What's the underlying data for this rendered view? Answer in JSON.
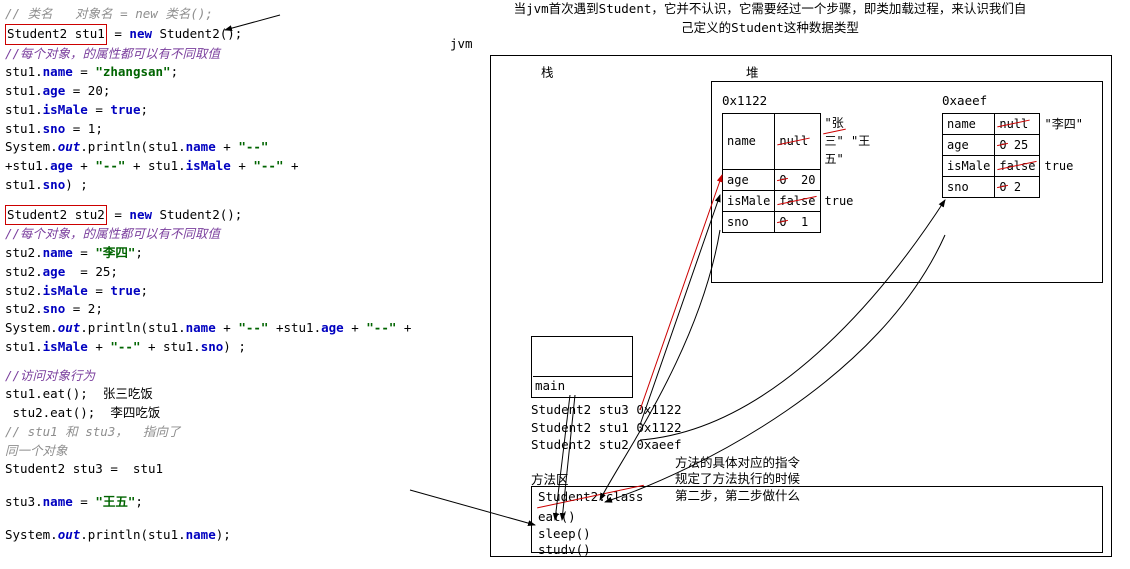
{
  "code": {
    "c0": "// 类名   对象名 = new 类名();",
    "l1a": "Student2 stu1",
    "l1b": " = ",
    "l1c": "new",
    "l1d": " Student2();",
    "c1": "//每个对象，的属性都可以有不同取值",
    "l2a": "stu1.",
    "l2b": "name",
    "l2c": " = ",
    "l2d": "\"zhangsan\"",
    "l2e": ";",
    "l3a": "stu1.",
    "l3b": "age",
    "l3c": " = 20;",
    "l4a": "stu1.",
    "l4b": "isMale",
    "l4c": " = ",
    "l4d": "true",
    "l4e": ";",
    "l5a": "stu1.",
    "l5b": "sno",
    "l5c": " = 1;",
    "l6a": "System.",
    "l6b": "out",
    "l6c": ".println(stu1.",
    "l6d": "name",
    "l6e": " + ",
    "l6f": "\"--\"",
    "l7a": "+stu1.",
    "l7b": "age",
    "l7c": " + ",
    "l7d": "\"--\"",
    "l7e": " + stu1.",
    "l7f": "isMale",
    "l7g": " + ",
    "l7h": "\"--\"",
    "l7i": " +",
    "l8a": "stu1.",
    "l8b": "sno",
    "l8c": ") ;",
    "l9a": "Student2 stu2",
    "l9b": " = ",
    "l9c": "new",
    "l9d": " Student2();",
    "c2": "//每个对象，的属性都可以有不同取值",
    "l10a": "stu2.",
    "l10b": "name",
    "l10c": " = ",
    "l10d": "\"李四\"",
    "l10e": ";",
    "l11a": "stu2.",
    "l11b": "age",
    "l11c": "  = 25;",
    "l12a": "stu2.",
    "l12b": "isMale",
    "l12c": " = ",
    "l12d": "true",
    "l12e": ";",
    "l13a": "stu2.",
    "l13b": "sno",
    "l13c": " = 2;",
    "l14a": "System.",
    "l14b": "out",
    "l14c": ".println(stu1.",
    "l14d": "name",
    "l14e": " + ",
    "l14f": "\"--\"",
    "l14g": " +stu1.",
    "l14h": "age",
    "l14i": " + ",
    "l14j": "\"--\"",
    "l14k": " +",
    "l15a": "stu1.",
    "l15b": "isMale",
    "l15c": " + ",
    "l15d": "\"--\"",
    "l15e": " + stu1.",
    "l15f": "sno",
    "l15g": ") ;",
    "c3": "//访问对象行为",
    "l16": "stu1.eat();  张三吃饭",
    "l17": " stu2.eat();  李四吃饭",
    "c4": "// stu1 和 stu3，  指向了",
    "c5": "同一个对象",
    "l18": "Student2 stu3 =  stu1",
    "l19a": "stu3.",
    "l19b": "name",
    "l19c": " = ",
    "l19d": "\"王五\"",
    "l19e": ";",
    "l20a": "System.",
    "l20b": "out",
    "l20c": ".println(stu1.",
    "l20d": "name",
    "l20e": ");"
  },
  "anno": {
    "top1": "当jvm首次遇到Student，它并不认识，它需要经过一个步骤，即类加载过程，来认识我们自",
    "top2": "己定义的Student这种数据类型",
    "jvm": "jvm",
    "stack": "栈",
    "heap": "堆",
    "main": "main",
    "sv1": "Student2 stu3  0x1122",
    "sv2": "Student2 stu1  0x1122",
    "sv3": "Student2 stu2  0xaeef",
    "method": "方法区",
    "mclass": "Student2.class",
    "meat": "eat()",
    "msleep": "sleep()",
    "mstudy": "studv()",
    "side1a": "方法的具体对应的指令",
    "side1b": "规定了方法执行的时候",
    "side1c": "第二步，第二步做什么"
  },
  "obj1": {
    "addr": "0x1122",
    "name_k": "name",
    "name_v1": "null",
    "name_v2": "\"张三\"",
    "name_v3": "\"王五\"",
    "age_k": "age",
    "age_v1": "0",
    "age_v2": "20",
    "ismale_k": "isMale",
    "ismale_v1": "false",
    "ismale_v2": "true",
    "sno_k": "sno",
    "sno_v1": "0",
    "sno_v2": "1"
  },
  "obj2": {
    "addr": "0xaeef",
    "name_k": "name",
    "name_v1": "null",
    "name_v2": "\"李四\"",
    "age_k": "age",
    "age_v1": "0",
    "age_v2": "25",
    "ismale_k": "isMale",
    "ismale_v1": "false",
    "ismale_v2": "true",
    "sno_k": "sno",
    "sno_v1": "0",
    "sno_v2": "2"
  }
}
